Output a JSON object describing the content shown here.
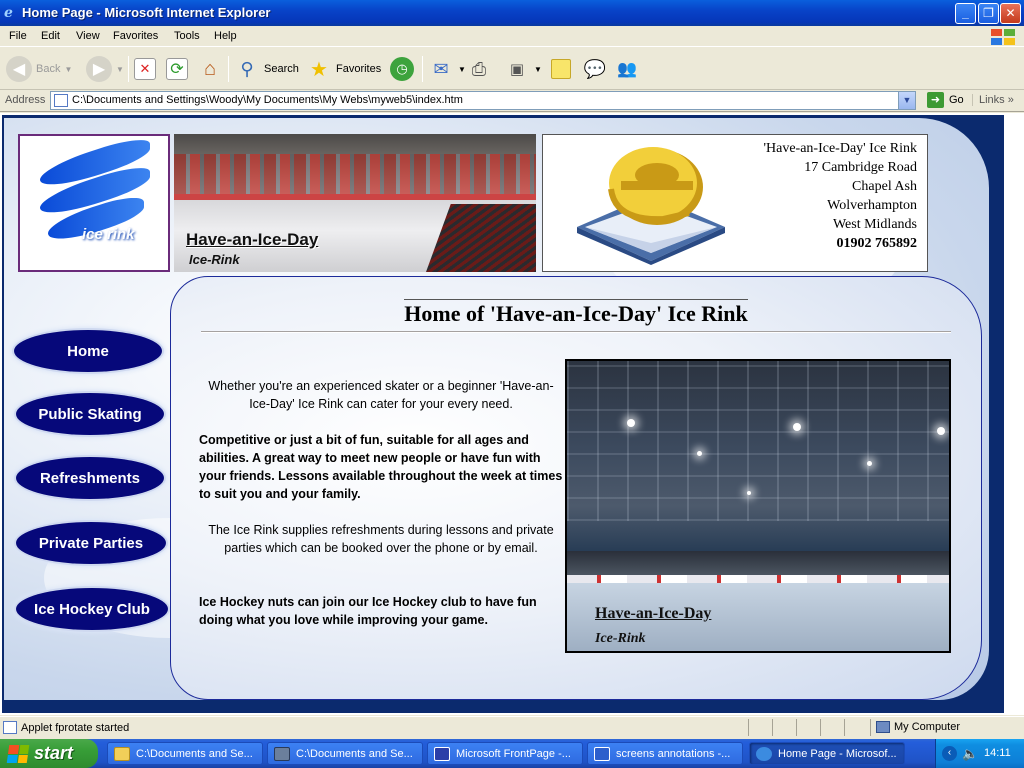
{
  "window": {
    "title": "Home Page - Microsoft Internet Explorer",
    "controls": [
      "_",
      "❐",
      "✕"
    ]
  },
  "menu": [
    "File",
    "Edit",
    "View",
    "Favorites",
    "Tools",
    "Help"
  ],
  "toolbar": {
    "back": "Back",
    "search": "Search",
    "favorites": "Favorites"
  },
  "address": {
    "label": "Address",
    "url": "C:\\Documents and Settings\\Woody\\My Documents\\My Webs\\myweb5\\index.htm",
    "go": "Go",
    "links": "Links"
  },
  "page": {
    "logo_text": "ice rink",
    "banner_caption": "Have-an-Ice-Day",
    "banner_subcaption": "Ice-Rink",
    "contact": {
      "name": "'Have-an-Ice-Day' Ice Rink",
      "street": "17 Cambridge Road",
      "area": "Chapel Ash",
      "town": "Wolverhampton",
      "county": "West Midlands",
      "phone": "01902 765892"
    },
    "heading": "Home of 'Have-an-Ice-Day' Ice Rink",
    "paragraphs": [
      "Whether you're an experienced skater or a beginner 'Have-an-Ice-Day' Ice Rink can cater for your every need.",
      "Competitive or just a bit of fun, suitable for all ages and abilities. A great way to meet new people or have fun with your friends. Lessons available throughout the week at times to suit you and your family.",
      "The Ice Rink supplies refreshments during lessons and private parties which can be booked over the phone or by email.",
      "Ice Hockey nuts can join our Ice Hockey club to have fun doing what you love while improving your game."
    ],
    "photo_caption": "Have-an-Ice-Day",
    "photo_subcaption": "Ice-Rink",
    "nav": [
      "Home",
      "Public Skating",
      "Refreshments",
      "Private Parties",
      "Ice Hockey Club"
    ]
  },
  "status": {
    "text": "Applet fprotate started",
    "zone": "My Computer"
  },
  "taskbar": {
    "start": "start",
    "tasks": [
      "C:\\Documents and Se...",
      "C:\\Documents and Se...",
      "Microsoft FrontPage -...",
      "screens annotations -...",
      "Home Page - Microsof..."
    ],
    "clock": "14:11"
  }
}
